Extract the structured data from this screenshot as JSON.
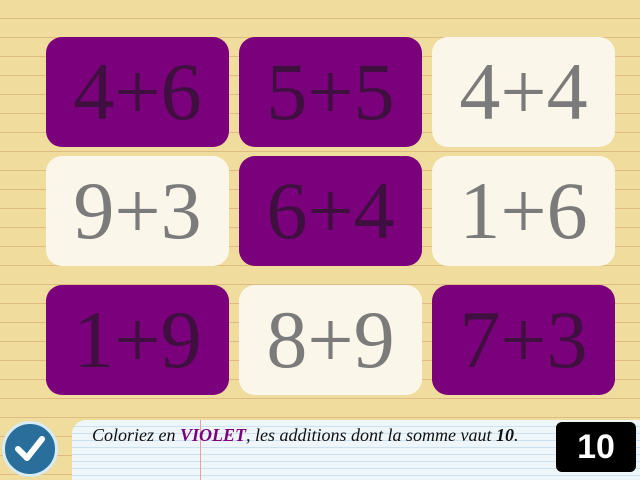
{
  "tiles": [
    {
      "label": "4+6",
      "state": "violet"
    },
    {
      "label": "5+5",
      "state": "violet"
    },
    {
      "label": "4+4",
      "state": "white"
    },
    {
      "label": "9+3",
      "state": "white"
    },
    {
      "label": "6+4",
      "state": "violet"
    },
    {
      "label": "1+6",
      "state": "white"
    },
    {
      "label": "1+9",
      "state": "violet"
    },
    {
      "label": "8+9",
      "state": "white"
    },
    {
      "label": "7+3",
      "state": "violet"
    }
  ],
  "instruction": {
    "before": "Coloriez en ",
    "color_word": "VIOLET",
    "after": ", les additions dont la somme vaut ",
    "target": "10",
    "end": "."
  },
  "counter": "10",
  "check_button": {
    "icon": "checkmark-icon"
  },
  "colors": {
    "violet": "#7b007b",
    "violet_text": "#3f0f3f",
    "white_tile": "#fbf6ea",
    "white_text": "#7b7b7b",
    "paper": "#f0dc9c"
  }
}
